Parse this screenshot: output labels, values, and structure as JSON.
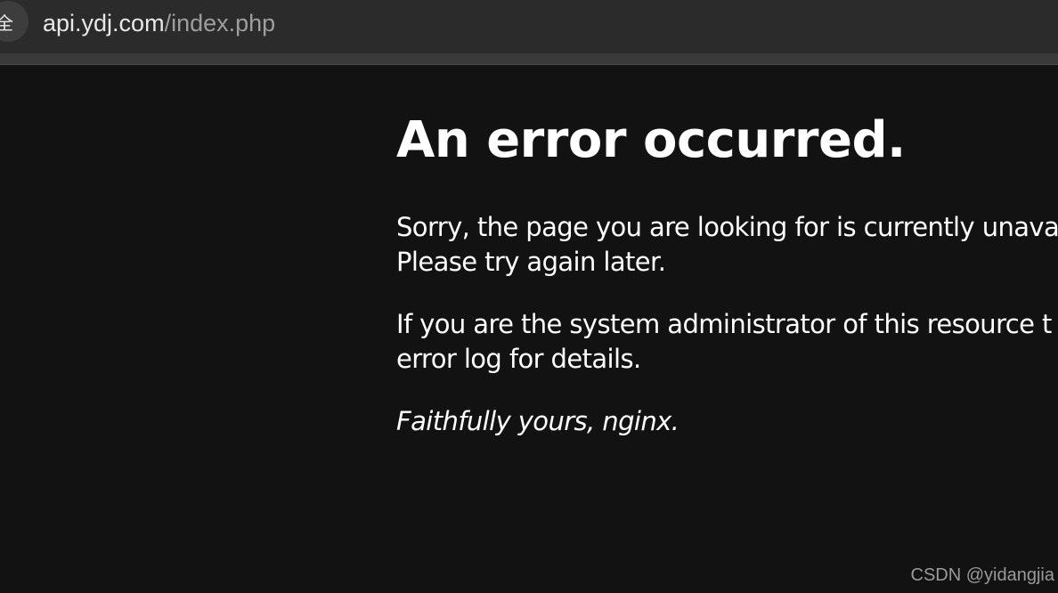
{
  "browser": {
    "site_info_label": "全",
    "url_host": "api.ydj.com",
    "url_path": "/index.php"
  },
  "error_page": {
    "title": "An error occurred.",
    "paragraph1_line1": "Sorry, the page you are looking for is currently unava",
    "paragraph1_line2": "Please try again later.",
    "paragraph2_line1": "If you are the system administrator of this resource t",
    "paragraph2_line2": "error log for details.",
    "signature": "Faithfully yours, nginx."
  },
  "watermark": "CSDN @yidangjia",
  "colors": {
    "page_background": "#121212",
    "text": "#ffffff",
    "chrome": "#2b2b2b"
  }
}
